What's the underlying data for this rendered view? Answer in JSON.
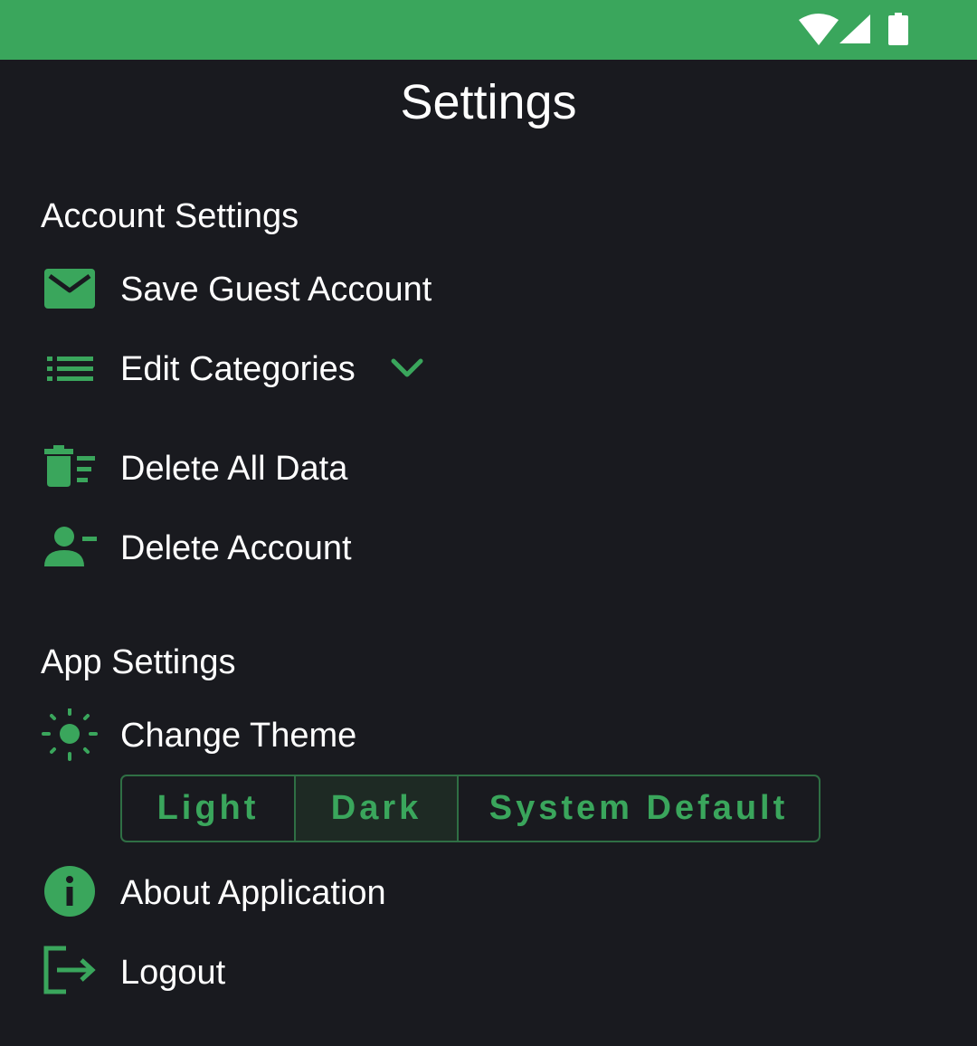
{
  "colors": {
    "accent": "#3aa65c",
    "background": "#191a1f",
    "text": "#ffffff",
    "status_bar": "#3aa65c",
    "segment_border": "#2f6f44",
    "segment_selected_bg": "#1e2a24"
  },
  "status_bar": {
    "icons": [
      "wifi-icon",
      "cell-signal-icon",
      "battery-icon"
    ]
  },
  "header": {
    "title": "Settings"
  },
  "account_settings": {
    "title": "Account Settings",
    "items": [
      {
        "icon": "envelope-icon",
        "label": "Save Guest Account"
      },
      {
        "icon": "list-icon",
        "label": "Edit Categories",
        "trailing_icon": "chevron-down-icon"
      },
      {
        "icon": "delete-sweep-icon",
        "label": "Delete All Data"
      },
      {
        "icon": "person-remove-icon",
        "label": "Delete Account"
      }
    ]
  },
  "app_settings": {
    "title": "App Settings",
    "change_theme": {
      "icon": "sun-icon",
      "label": "Change Theme"
    },
    "theme_options": [
      {
        "label": "Light",
        "selected": false
      },
      {
        "label": "Dark",
        "selected": true
      },
      {
        "label": "System Default",
        "selected": false
      }
    ],
    "items": [
      {
        "icon": "info-icon",
        "label": "About Application"
      },
      {
        "icon": "logout-icon",
        "label": "Logout"
      }
    ]
  }
}
